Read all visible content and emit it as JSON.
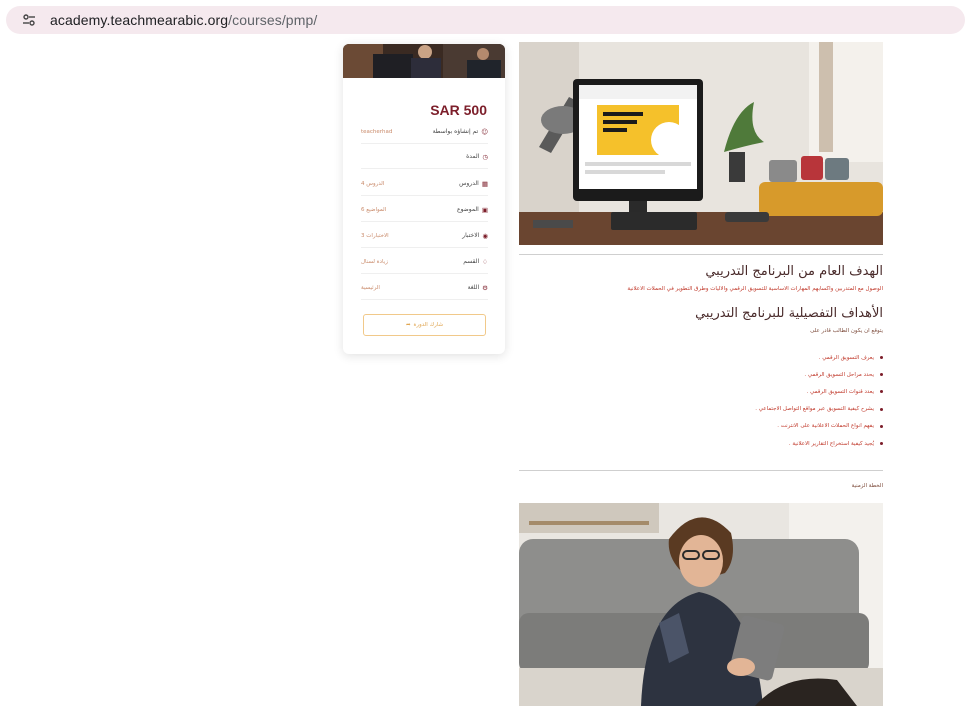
{
  "browser": {
    "url_host": "academy.teachmearabic.org",
    "url_path": "/courses/pmp/"
  },
  "card": {
    "price": "SAR 500",
    "rows": [
      {
        "label": "تم إنشاؤه بواسطة",
        "value": "teacherhad",
        "icon": "user-icon"
      },
      {
        "label": "المدة",
        "value": "",
        "icon": "clock-icon"
      },
      {
        "label": "الدروس",
        "value": "4 الدروس",
        "icon": "book-icon"
      },
      {
        "label": "الموضوع",
        "value": "6 المواضيع",
        "icon": "topic-icon"
      },
      {
        "label": "الاختبار",
        "value": "3 الاختبارات",
        "icon": "quiz-icon"
      },
      {
        "label": "القسم",
        "value": "زيادة لسنال",
        "icon": "tag-icon"
      },
      {
        "label": "اللغة",
        "value": "الرئيسية",
        "icon": "language-icon"
      }
    ],
    "share_label": "شارك الدورة"
  },
  "main": {
    "goal_title": "الهدف العام من البرنامج التدريبي",
    "goal_text": "الوصول مع المتدربين واكسابهم المهارات الاساسية للتسويق الرقمي والاليات وطرق التطوير في الحملات الاعلانية",
    "detail_title": "الأهداف التفصيلية للبرنامج التدريبي",
    "detail_intro": "يتوقع ان يكون الطالب قادر على",
    "goals": [
      "يعرف التسويق الرقمي .",
      "يحدد مراحل التسويق الرقمي .",
      "يعدد قنوات التسويق الرقمي .",
      "يشرح كيفية التسويق عبر مواقع التواصل الاجتماعي .",
      "يفهم انواع الحملات الاعلانية على الانترنت .",
      "يُجيد كيفية استخراج التقارير الاعلانية ."
    ],
    "plan_label": "الخطة الزمنية"
  },
  "colors": {
    "accent": "#7c1e2a",
    "link_red": "#c0392b",
    "share_border": "#f1c98a"
  }
}
